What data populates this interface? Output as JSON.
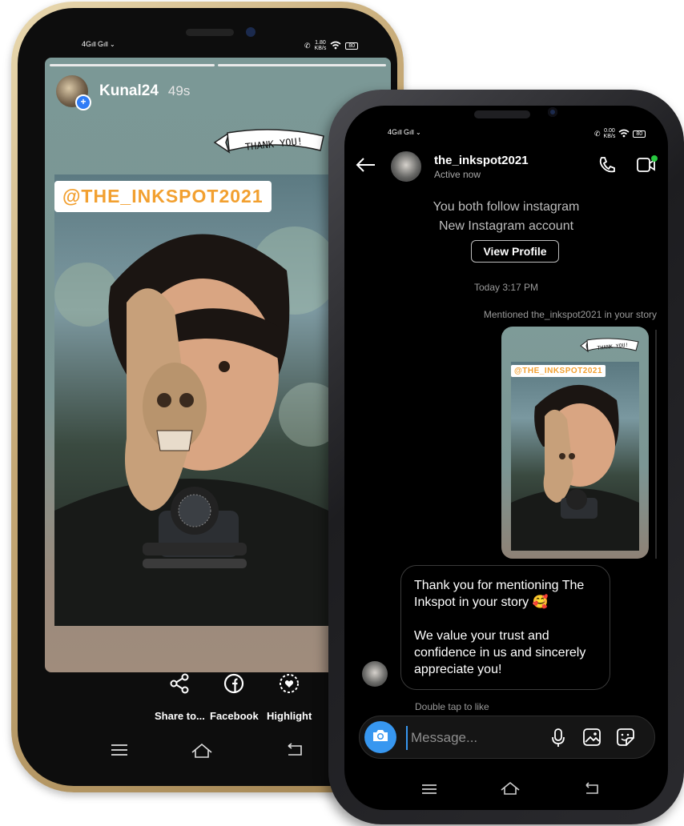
{
  "back_phone": {
    "status": {
      "network": "4G",
      "network2": "G",
      "speed": "1.80",
      "speed_unit": "KB/s",
      "battery": "80"
    },
    "story": {
      "username": "Kunal24",
      "time": "49s",
      "sticker_text": "THANK YOU!",
      "mention_tag": "@THE_INKSPOT2021",
      "progress_segments": 2
    },
    "actions": [
      {
        "label": "Share to...",
        "icon": "share-icon"
      },
      {
        "label": "Facebook",
        "icon": "facebook-icon"
      },
      {
        "label": "Highlight",
        "icon": "highlight-icon"
      }
    ],
    "nav": [
      "menu-icon",
      "home-icon",
      "back-icon"
    ]
  },
  "front_phone": {
    "status": {
      "network": "4G",
      "network2": "G",
      "speed": "0.00",
      "speed_unit": "KB/s",
      "battery": "80"
    },
    "header": {
      "name": "the_inkspot2021",
      "status": "Active now"
    },
    "profile_info": {
      "line1": "You both follow instagram",
      "line2": "New Instagram account",
      "view_profile": "View Profile"
    },
    "timestamp": "Today 3:17 PM",
    "mention_note": "Mentioned the_inkspot2021 in your story",
    "story_thumb": {
      "sticker_text": "THANK YOU!",
      "mention_tag": "@THE_INKSPOT2021"
    },
    "message": {
      "para1": "Thank you for mentioning The Inkspot in your story 🥰",
      "para2": "We value your trust and confidence in us and sincerely appreciate you!"
    },
    "double_tap": "Double tap to like",
    "composer": {
      "placeholder": "Message..."
    },
    "nav": [
      "menu-icon",
      "home-icon",
      "back-icon"
    ]
  },
  "colors": {
    "accent": "#3797f0",
    "tag": "#f2a030",
    "gold": "#c4a774"
  }
}
